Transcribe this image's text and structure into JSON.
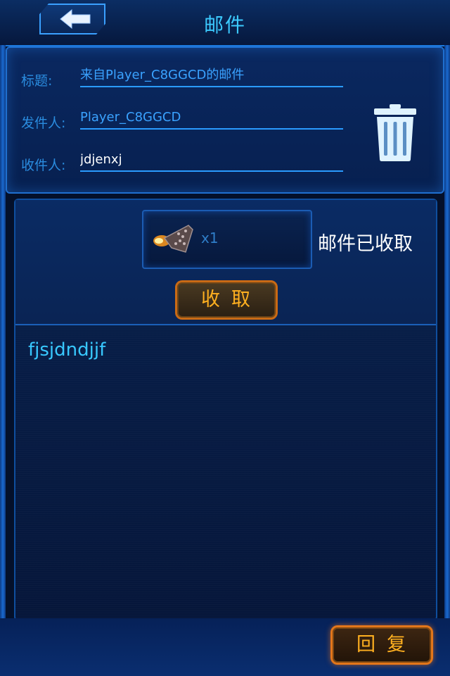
{
  "header": {
    "title": "邮件",
    "back_icon": "back-arrow-icon"
  },
  "mail": {
    "subject_label": "标题:",
    "subject_value": "来自Player_C8GGCD的邮件",
    "sender_label": "发件人:",
    "sender_value": "Player_C8GGCD",
    "recipient_label": "收件人:",
    "recipient_value": "jdjenxj",
    "body": "fjsjdndjjf"
  },
  "attachment": {
    "item_icon": "ship-wing-item-icon",
    "count": "x1",
    "status": "邮件已收取",
    "collect_label": "收取"
  },
  "actions": {
    "delete_icon": "trash-icon",
    "reply_label": "回复"
  },
  "colors": {
    "accent_blue": "#3ccaff",
    "button_orange": "#ffb020",
    "background": "#04102a"
  }
}
